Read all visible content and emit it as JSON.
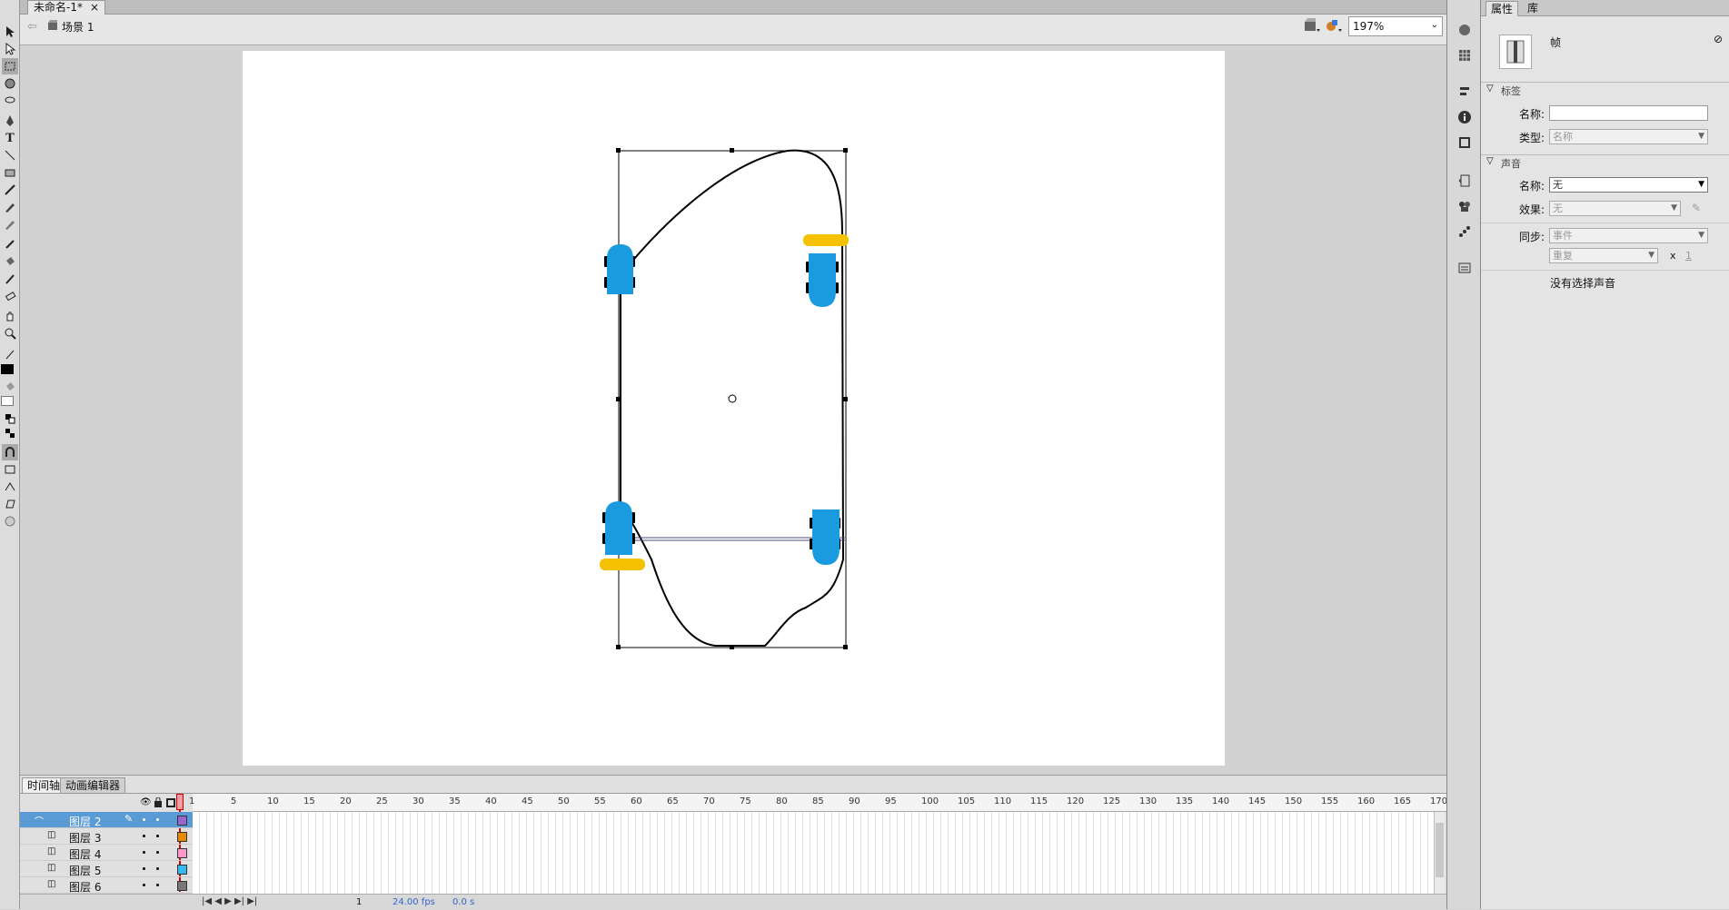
{
  "document": {
    "tab_title": "未命名-1*",
    "close": "×"
  },
  "editbar": {
    "scene_label": "场景 1",
    "zoom": "197%"
  },
  "timeline": {
    "tabs": [
      "时间轴",
      "动画编辑器"
    ],
    "ruler": [
      "1",
      "5",
      "10",
      "15",
      "20",
      "25",
      "30",
      "35",
      "40",
      "45",
      "50",
      "55",
      "60",
      "65",
      "70",
      "75",
      "80",
      "85",
      "90",
      "95",
      "100",
      "105",
      "110",
      "115",
      "120",
      "125",
      "130",
      "135",
      "140",
      "145",
      "150",
      "155",
      "160",
      "165",
      "170"
    ],
    "layers": [
      {
        "name": "图层 2",
        "color": "#9966cc",
        "selected": true
      },
      {
        "name": "图层 3",
        "color": "#e68a00",
        "selected": false
      },
      {
        "name": "图层 4",
        "color": "#ff99cc",
        "selected": false
      },
      {
        "name": "图层 5",
        "color": "#33bbee",
        "selected": false
      },
      {
        "name": "图层 6",
        "color": "#777777",
        "selected": false
      }
    ],
    "status": {
      "frame": "1",
      "fps": "24.00 fps",
      "time": "0.0 s"
    }
  },
  "properties": {
    "tabs": [
      "属性",
      "库"
    ],
    "object_type": "帧",
    "label_section": "标签",
    "label_name": "名称:",
    "label_type": "类型:",
    "label_type_value": "名称",
    "sound_section": "声音",
    "sound_name": "名称:",
    "sound_name_value": "无",
    "effect": "效果:",
    "effect_value": "无",
    "sync": "同步:",
    "sync_value": "事件",
    "repeat_value": "重复",
    "repeat_x": "x",
    "repeat_count": "1",
    "no_sound": "没有选择声音"
  },
  "colors": {
    "accent": "#1a9be0",
    "wheel_yellow": "#f5c100",
    "selection": "#5b9bd5"
  }
}
